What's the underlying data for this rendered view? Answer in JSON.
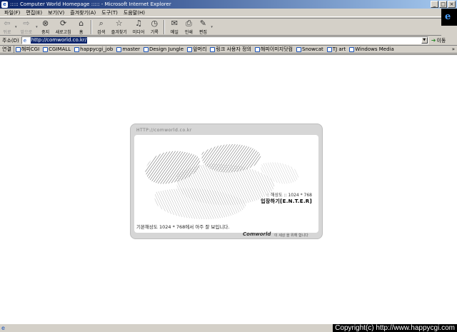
{
  "window": {
    "title": "::::: Computer World Homepage ::::: - Microsoft Internet Explorer",
    "buttons": {
      "minimize": "_",
      "maximize": "□",
      "close": "×"
    }
  },
  "menu": [
    "파일(F)",
    "편집(E)",
    "보기(V)",
    "즐겨찾기(A)",
    "도구(T)",
    "도움말(H)"
  ],
  "toolbar": {
    "back": "뒤로",
    "forward": "앞으로",
    "stop": "중지",
    "refresh": "새로고침",
    "home": "홈",
    "search": "검색",
    "favorites": "즐겨찾기",
    "media": "미디어",
    "history": "기록",
    "mail": "메일",
    "print": "인쇄",
    "edit": "편집"
  },
  "address": {
    "label": "주소(D)",
    "url": "http://comworld.co.kr/",
    "go": "이동"
  },
  "links": {
    "label": "연결",
    "items": [
      "해피CGI",
      "CGIMALL",
      "happycgi_job",
      "master",
      "Design Jungle",
      "앞머리",
      "링크 사용자 정의",
      "해피이미지닷컴",
      "Snowcat",
      "TJ art",
      "Windows Media"
    ],
    "more": "»"
  },
  "splash": {
    "url": "HTTP://comworld.co.kr",
    "resolution": ":: 해상도 :: 1024 * 768",
    "enter": "입장하기[E.N.T.E.R]",
    "info": "기본해상도 1024 * 768에서 아주 잘 보입니다.",
    "brand": "Comworld",
    "brand_sub": "이 세상 을 위해 합니다"
  },
  "status": {
    "copyright": "Copyright(c) http://www.happycgi.com"
  },
  "colors": {
    "titlebar_start": "#0a246a",
    "titlebar_end": "#a6caf0",
    "chrome": "#d4d0c8",
    "selection": "#0a246a"
  }
}
